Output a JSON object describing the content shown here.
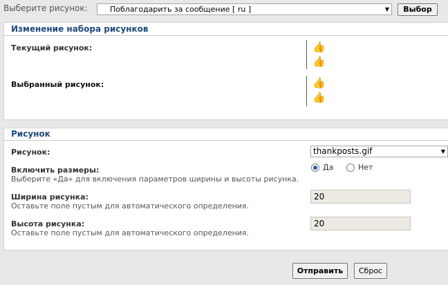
{
  "top_bar": {
    "label": "Выберите рисунок:",
    "selected": "Поблагодарить за сообщение [ ru ]",
    "select_button": "Выбор"
  },
  "set_section": {
    "title": "Изменение набора рисунков",
    "current_label": "Текущий рисунок:",
    "chosen_label": "Выбранный рисунок:",
    "thumb_glyph": "👍"
  },
  "image_section": {
    "title": "Рисунок",
    "image_label": "Рисунок:",
    "image_value": "thankposts.gif",
    "sizes_label": "Включить размеры:",
    "sizes_hint": "Выберите «Да» для включения параметров ширины и высоты рисунка.",
    "radio_yes": "Да",
    "radio_no": "Нет",
    "radio_selected": "yes",
    "width_label": "Ширина рисунка:",
    "width_hint": "Оставьте поле пустым для автоматического определения.",
    "width_value": "20",
    "height_label": "Высота рисунка:",
    "height_hint": "Оставьте поле пустым для автоматического определения.",
    "height_value": "20"
  },
  "actions": {
    "submit": "Отправить",
    "reset": "Сброс"
  },
  "icons": {
    "dropdown_arrow": "chevron-down-icon",
    "thumb": "thumbs-up-icon"
  }
}
